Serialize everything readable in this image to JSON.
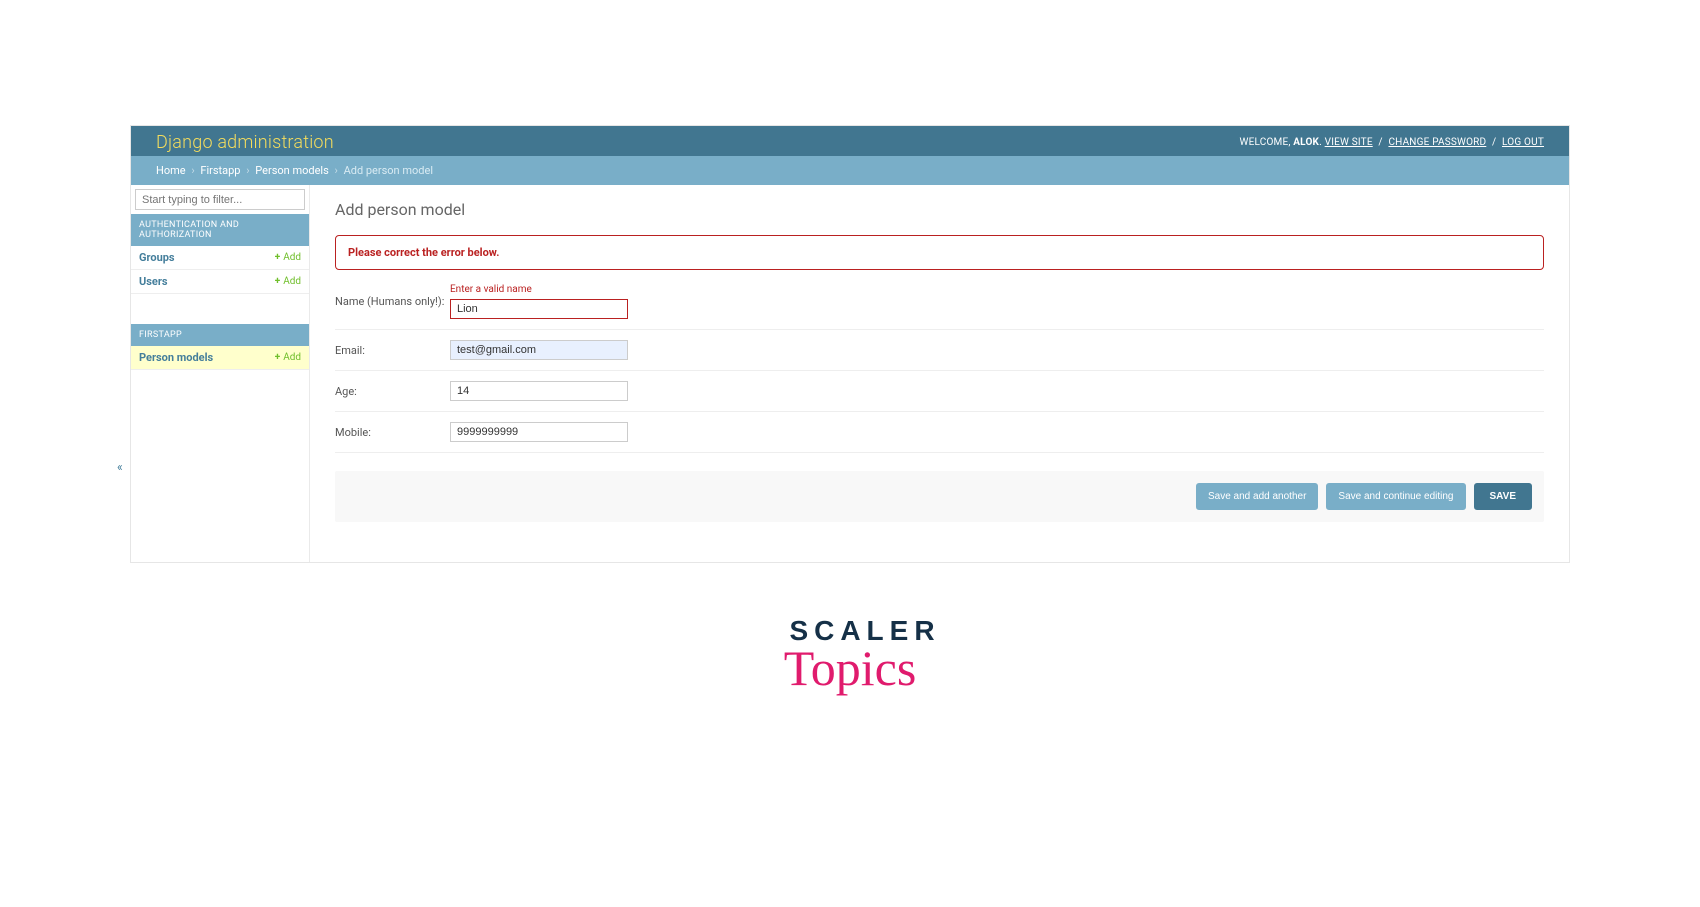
{
  "header": {
    "brand": "Django administration",
    "welcome": "WELCOME,",
    "user": "ALOK",
    "view_site": "VIEW SITE",
    "change_password": "CHANGE PASSWORD",
    "logout": "LOG OUT"
  },
  "breadcrumbs": {
    "home": "Home",
    "app": "Firstapp",
    "model": "Person models",
    "current": "Add person model"
  },
  "sidebar": {
    "filter_placeholder": "Start typing to filter...",
    "auth_caption": "AUTHENTICATION AND AUTHORIZATION",
    "auth_items": [
      {
        "label": "Groups",
        "add": "Add"
      },
      {
        "label": "Users",
        "add": "Add"
      }
    ],
    "app_caption": "FIRSTAPP",
    "app_items": [
      {
        "label": "Person models",
        "add": "Add"
      }
    ]
  },
  "page": {
    "title": "Add person model",
    "error_note": "Please correct the error below."
  },
  "form": {
    "name_label": "Name (Humans only!):",
    "name_error": "Enter a valid name",
    "name_value": "Lion",
    "email_label": "Email:",
    "email_value": "test@gmail.com",
    "age_label": "Age:",
    "age_value": "14",
    "mobile_label": "Mobile:",
    "mobile_value": "9999999999"
  },
  "buttons": {
    "save_add_another": "Save and add another",
    "save_continue": "Save and continue editing",
    "save": "SAVE"
  },
  "watermark": {
    "line1": "SCALER",
    "line2": "Topics"
  }
}
